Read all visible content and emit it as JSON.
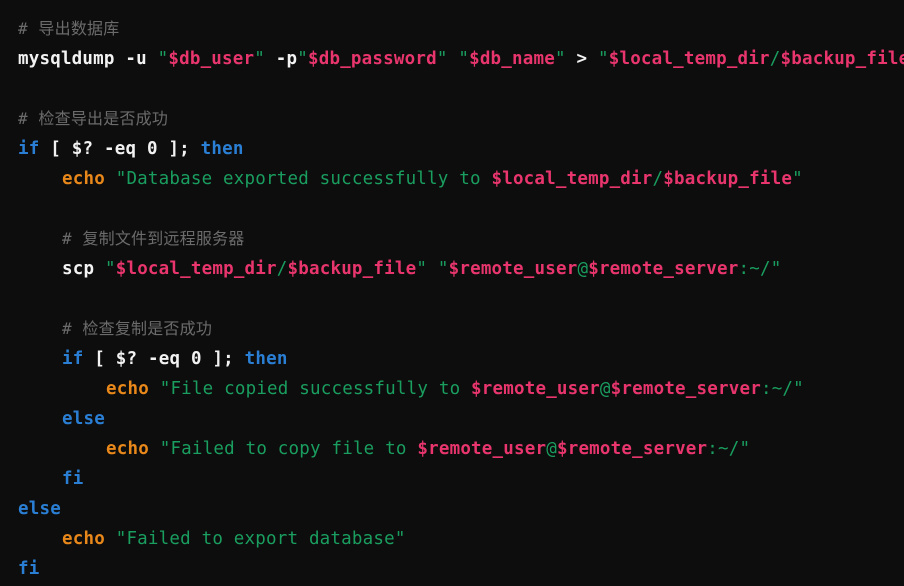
{
  "editor": {
    "language": "bash",
    "background_color": "#0d0d0d",
    "theme_colors": {
      "comment": "#6b6b6b",
      "keyword": "#2a7fd4",
      "builtin": "#e8871a",
      "command": "#f2f2f2",
      "string": "#1a9e5f",
      "variable": "#e8356d",
      "operator": "#f2f2f2"
    }
  },
  "lines": [
    {
      "id": 1,
      "indent": 0,
      "tokens": [
        {
          "type": "comment",
          "text": "#  导出数据库"
        }
      ]
    },
    {
      "id": 2,
      "indent": 0,
      "tokens": [
        {
          "type": "command",
          "text": "mysqldump"
        },
        {
          "type": "plain",
          "text": " "
        },
        {
          "type": "operator",
          "text": "-u"
        },
        {
          "type": "plain",
          "text": " "
        },
        {
          "type": "string",
          "text": "\""
        },
        {
          "type": "var",
          "text": "$db_user"
        },
        {
          "type": "string",
          "text": "\""
        },
        {
          "type": "plain",
          "text": " "
        },
        {
          "type": "operator",
          "text": "-p"
        },
        {
          "type": "string",
          "text": "\""
        },
        {
          "type": "var",
          "text": "$db_password"
        },
        {
          "type": "string",
          "text": "\""
        },
        {
          "type": "plain",
          "text": " "
        },
        {
          "type": "string",
          "text": "\""
        },
        {
          "type": "var",
          "text": "$db_name"
        },
        {
          "type": "string",
          "text": "\""
        },
        {
          "type": "plain",
          "text": " "
        },
        {
          "type": "operator",
          "text": ">"
        },
        {
          "type": "plain",
          "text": " "
        },
        {
          "type": "string",
          "text": "\""
        },
        {
          "type": "var",
          "text": "$local_temp_dir"
        },
        {
          "type": "string",
          "text": "/"
        },
        {
          "type": "var",
          "text": "$backup_file"
        },
        {
          "type": "string",
          "text": "\""
        }
      ]
    },
    {
      "id": 3,
      "indent": 0,
      "tokens": []
    },
    {
      "id": 4,
      "indent": 0,
      "tokens": [
        {
          "type": "comment",
          "text": "#  检查导出是否成功"
        }
      ]
    },
    {
      "id": 5,
      "indent": 0,
      "tokens": [
        {
          "type": "keyword",
          "text": "if"
        },
        {
          "type": "plain",
          "text": " "
        },
        {
          "type": "operator",
          "text": "["
        },
        {
          "type": "plain",
          "text": " "
        },
        {
          "type": "operator",
          "text": "$?"
        },
        {
          "type": "plain",
          "text": " "
        },
        {
          "type": "operator",
          "text": "-eq"
        },
        {
          "type": "plain",
          "text": " "
        },
        {
          "type": "operator",
          "text": "0"
        },
        {
          "type": "plain",
          "text": " "
        },
        {
          "type": "operator",
          "text": "];"
        },
        {
          "type": "plain",
          "text": " "
        },
        {
          "type": "keyword",
          "text": "then"
        }
      ]
    },
    {
      "id": 6,
      "indent": 1,
      "tokens": [
        {
          "type": "builtin",
          "text": "echo"
        },
        {
          "type": "plain",
          "text": " "
        },
        {
          "type": "string",
          "text": "\"Database exported successfully to "
        },
        {
          "type": "var",
          "text": "$local_temp_dir"
        },
        {
          "type": "string",
          "text": "/"
        },
        {
          "type": "var",
          "text": "$backup_file"
        },
        {
          "type": "string",
          "text": "\""
        }
      ]
    },
    {
      "id": 7,
      "indent": 0,
      "tokens": []
    },
    {
      "id": 8,
      "indent": 1,
      "tokens": [
        {
          "type": "comment",
          "text": "#  复制文件到远程服务器"
        }
      ]
    },
    {
      "id": 9,
      "indent": 1,
      "tokens": [
        {
          "type": "command",
          "text": "scp"
        },
        {
          "type": "plain",
          "text": " "
        },
        {
          "type": "string",
          "text": "\""
        },
        {
          "type": "var",
          "text": "$local_temp_dir"
        },
        {
          "type": "string",
          "text": "/"
        },
        {
          "type": "var",
          "text": "$backup_file"
        },
        {
          "type": "string",
          "text": "\""
        },
        {
          "type": "plain",
          "text": " "
        },
        {
          "type": "string",
          "text": "\""
        },
        {
          "type": "var",
          "text": "$remote_user"
        },
        {
          "type": "string",
          "text": "@"
        },
        {
          "type": "var",
          "text": "$remote_server"
        },
        {
          "type": "string",
          "text": ":~/\""
        }
      ]
    },
    {
      "id": 10,
      "indent": 0,
      "tokens": []
    },
    {
      "id": 11,
      "indent": 1,
      "tokens": [
        {
          "type": "comment",
          "text": "#  检查复制是否成功"
        }
      ]
    },
    {
      "id": 12,
      "indent": 1,
      "tokens": [
        {
          "type": "keyword",
          "text": "if"
        },
        {
          "type": "plain",
          "text": " "
        },
        {
          "type": "operator",
          "text": "["
        },
        {
          "type": "plain",
          "text": " "
        },
        {
          "type": "operator",
          "text": "$?"
        },
        {
          "type": "plain",
          "text": " "
        },
        {
          "type": "operator",
          "text": "-eq"
        },
        {
          "type": "plain",
          "text": " "
        },
        {
          "type": "operator",
          "text": "0"
        },
        {
          "type": "plain",
          "text": " "
        },
        {
          "type": "operator",
          "text": "];"
        },
        {
          "type": "plain",
          "text": " "
        },
        {
          "type": "keyword",
          "text": "then"
        }
      ]
    },
    {
      "id": 13,
      "indent": 2,
      "tokens": [
        {
          "type": "builtin",
          "text": "echo"
        },
        {
          "type": "plain",
          "text": " "
        },
        {
          "type": "string",
          "text": "\"File copied successfully to "
        },
        {
          "type": "var",
          "text": "$remote_user"
        },
        {
          "type": "string",
          "text": "@"
        },
        {
          "type": "var",
          "text": "$remote_server"
        },
        {
          "type": "string",
          "text": ":~/\""
        }
      ]
    },
    {
      "id": 14,
      "indent": 1,
      "tokens": [
        {
          "type": "keyword",
          "text": "else"
        }
      ]
    },
    {
      "id": 15,
      "indent": 2,
      "tokens": [
        {
          "type": "builtin",
          "text": "echo"
        },
        {
          "type": "plain",
          "text": " "
        },
        {
          "type": "string",
          "text": "\"Failed to copy file to "
        },
        {
          "type": "var",
          "text": "$remote_user"
        },
        {
          "type": "string",
          "text": "@"
        },
        {
          "type": "var",
          "text": "$remote_server"
        },
        {
          "type": "string",
          "text": ":~/\""
        }
      ]
    },
    {
      "id": 16,
      "indent": 1,
      "tokens": [
        {
          "type": "keyword",
          "text": "fi"
        }
      ]
    },
    {
      "id": 17,
      "indent": 0,
      "tokens": [
        {
          "type": "keyword",
          "text": "else"
        }
      ]
    },
    {
      "id": 18,
      "indent": 1,
      "tokens": [
        {
          "type": "builtin",
          "text": "echo"
        },
        {
          "type": "plain",
          "text": " "
        },
        {
          "type": "string",
          "text": "\"Failed to export database\""
        }
      ]
    },
    {
      "id": 19,
      "indent": 0,
      "tokens": [
        {
          "type": "keyword",
          "text": "fi"
        }
      ]
    }
  ]
}
